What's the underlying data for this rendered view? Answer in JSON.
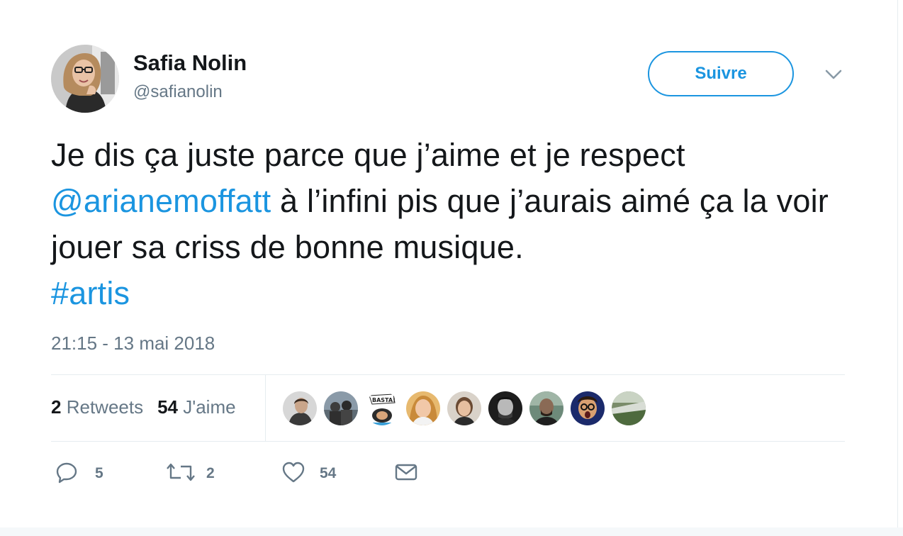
{
  "tweet": {
    "author_name": "Safia Nolin",
    "author_handle": "@safianolin",
    "follow_label": "Suivre",
    "text_part1": "Je dis ça juste parce que j’aime et je respect ",
    "mention": "@arianemoffatt",
    "text_part2": " à l’infini pis que j’aurais aimé ça la voir jouer sa criss de bonne musique. ",
    "hashtag": "#artis",
    "timestamp": "21:15 - 13 mai 2018"
  },
  "stats": {
    "retweets_count": "2",
    "retweets_label": "Retweets",
    "likes_count": "54",
    "likes_label": "J'aime"
  },
  "likers": [
    {
      "name": "liker-avatar-1"
    },
    {
      "name": "liker-avatar-2"
    },
    {
      "name": "liker-avatar-3",
      "badge_text": "BASTA!"
    },
    {
      "name": "liker-avatar-4"
    },
    {
      "name": "liker-avatar-5"
    },
    {
      "name": "liker-avatar-6"
    },
    {
      "name": "liker-avatar-7"
    },
    {
      "name": "liker-avatar-8"
    },
    {
      "name": "liker-avatar-9"
    }
  ],
  "actions": {
    "reply_count": "5",
    "retweet_count": "2",
    "like_count": "54"
  },
  "colors": {
    "accent": "#1b95e0",
    "muted": "#657786",
    "text": "#14171a",
    "divider": "#e6ecf0"
  },
  "icons": [
    "reply-icon",
    "retweet-icon",
    "heart-icon",
    "envelope-icon",
    "chevron-down-icon"
  ]
}
